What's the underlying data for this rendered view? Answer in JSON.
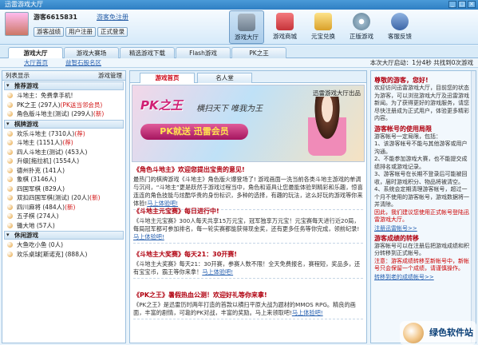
{
  "window": {
    "title": "迅雷游戏大厅",
    "buttons": [
      "_",
      "□",
      "×"
    ]
  },
  "header": {
    "username": "游客6615831",
    "register_link": "游客免注册",
    "buttons": [
      "游客战绩",
      "用户注册",
      "正式登录"
    ],
    "toolbar": [
      {
        "label": "游戏大厅",
        "icon": "joystick-icon",
        "color": "#7f8f9f"
      },
      {
        "label": "游戏商城",
        "icon": "bag-icon",
        "color": "#d8464a"
      },
      {
        "label": "元宝兑换",
        "icon": "coins-icon",
        "color": "#e8b43a"
      },
      {
        "label": "正版游戏",
        "icon": "disc-icon",
        "color": "#9bb7c9"
      },
      {
        "label": "客服反馈",
        "icon": "headset-icon",
        "color": "#4a78b8"
      }
    ]
  },
  "tabs": [
    "游戏大厅",
    "游戏大赛场",
    "精选游戏下载",
    "Flash游戏",
    "PK之王"
  ],
  "subbar": {
    "crumbs": [
      "大厅首页",
      "益智石股名区"
    ],
    "status": "本次大厅启动：1分4秒  共找到0次游戏"
  },
  "sidebar": {
    "list_label": "列表显示",
    "manage_label": "游戏管理",
    "categories": [
      {
        "name": "推荐游戏",
        "items": [
          {
            "name": "斗地主：免费拿手机!",
            "tag": ""
          },
          {
            "name": "PK之王 (297人)",
            "tag": "(PK送当邻会员)"
          },
          {
            "name": "角色版斗地主(测试) (299人)",
            "tag": "(新)"
          }
        ]
      },
      {
        "name": "棋牌游戏",
        "items": [
          {
            "name": "欢乐斗地主 (7310人)",
            "tag": "(荐)"
          },
          {
            "name": "斗地主 (1151人)",
            "tag": "(荐)"
          },
          {
            "name": "四人斗地主(测试) (453人)",
            "tag": ""
          },
          {
            "name": "升级[拖拉机] (1554人)",
            "tag": ""
          },
          {
            "name": "德州扑克 (141人)",
            "tag": ""
          },
          {
            "name": "象棋 (3146人)",
            "tag": ""
          },
          {
            "name": "四国军棋 (829人)",
            "tag": ""
          },
          {
            "name": "双扣四国军棋(测试) (20人)",
            "tag": "(新)"
          },
          {
            "name": "四川麻将 (484人)",
            "tag": "(新)"
          },
          {
            "name": "五子棋 (274人)",
            "tag": ""
          },
          {
            "name": "锄大地 (57人)",
            "tag": ""
          }
        ]
      },
      {
        "name": "休闲游戏",
        "items": [
          {
            "name": "大鱼吃小鱼 (0人)",
            "tag": ""
          },
          {
            "name": "欢乐桌球[斯诺克] (888人)",
            "tag": ""
          }
        ]
      }
    ]
  },
  "main": {
    "tabs": [
      "游戏首页",
      "名人堂"
    ],
    "banner": {
      "title": "PK之王",
      "slogan": "横扫天下 唯我为王",
      "pk_text": "PK就送 迅雷会员",
      "publisher": "迅雷游戏大厅出品"
    },
    "news": [
      {
        "title": "《角色斗地主》欢迎您提出宝贵的意见!",
        "date": "",
        "body": "最热门的棋牌游戏《斗地主》角色版火爆登场了! 游戏画面一洗当前各类斗地主游戏的单调与沉闷，“斗地主”更是跃然于游戏过程当中，角色和道具让您最能体验到精彩和乐趣，惊喜连连的角色技能与炫酷华贵的身份标识，多种的选择，有趣的玩法，这么好玩的游戏等你来体验!",
        "more": "马上体验吧!"
      },
      {
        "title": "《斗地主元宝赛》每日进行中!",
        "date": "",
        "body": "《斗地主元宝赛》300人每天共享15万元宝，冠军独享万元宝！元宝赛每天进行近20局，每局冠军都可参加排名，每一轮实赛都能获得现金奖，还有更多任务等你完成，领前纪录!",
        "more": "马上体验吧!"
      },
      {
        "title": "《斗地主大奖赛》每天21：30开赛!",
        "date": "",
        "body": "《斗地主大奖赛》每天21：30开赛，参赛人数不限！全天免费报名，赛程短，奖品多，还有宝宝币，霸王等你来拿！",
        "more": "马上体验吧!"
      },
      {
        "title": "《PK之王》暑假热血公测！欢迎好礼等你来拿!",
        "date": "",
        "body": "《PK之王》是迅雷历时两年打造的首款以横扫平原大战为题材的MMOS RPG。精良的画面，丰富的剧情，可靠的PK对战，丰富的奖励。马上来领取吧!",
        "more": "马上体验吧!"
      }
    ]
  },
  "right": {
    "sections": [
      {
        "title": "尊敬的游客，您好!",
        "paras": [
          {
            "text": "欢迎访问迅雷游戏大厅，目前您的状态为游客，可以浏览游戏大厅及迅雷游戏新闻。为了获得更好的游戏服务，请您尽快注册成为正式用户，体验更多精彩内容。",
            "red": false
          }
        ]
      },
      {
        "title": "游客帐号的使用局限",
        "paras": [
          {
            "text": "游客帐号一定局限，包括：",
            "red": false
          },
          {
            "text": "1、该游客帐号不能与其他游客或用户沟通。",
            "red": false
          },
          {
            "text": "2、不能参加游戏大赛，也不能提交成绩排名或游戏记录。",
            "red": false
          },
          {
            "text": "3、游客帐号在长期不登录后可能被回收，届时游戏积分、物品将被清空。",
            "red": false
          },
          {
            "text": "4、系统会定期清理游客帐号，超过一个月不使用的游客帐号，游戏数据将一并清除。",
            "red": false
          },
          {
            "text": "因此，我们建议您使用正式帐号登陆迅雷游戏大厅。",
            "red": true
          }
        ],
        "link": "注册迅雷帐号>>"
      },
      {
        "title": "游客成绩的转移",
        "paras": [
          {
            "text": "游客帐号可以在注册后把游戏成绩和积分转移到正式帐号。",
            "red": false
          },
          {
            "text": "注意：游客成绩转移至新帐号中，新帐号只会保留一个成绩，请谨慎操作。",
            "red": true
          }
        ],
        "link": "转移到老的成绩帐号>>"
      }
    ]
  },
  "watermark": "绿色软件站"
}
